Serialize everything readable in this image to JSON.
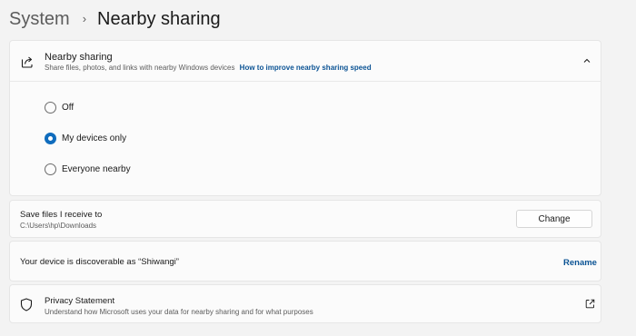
{
  "breadcrumb": {
    "parent": "System",
    "separator": "›",
    "current": "Nearby sharing"
  },
  "nearby_sharing": {
    "title": "Nearby sharing",
    "description": "Share files, photos, and links with nearby Windows devices",
    "help_link": "How to improve nearby sharing speed",
    "expanded": true,
    "options": [
      {
        "label": "Off",
        "checked": false
      },
      {
        "label": "My devices only",
        "checked": true
      },
      {
        "label": "Everyone nearby",
        "checked": false
      }
    ]
  },
  "save_files": {
    "title": "Save files I receive to",
    "path": "C:\\Users\\hp\\Downloads",
    "button_label": "Change"
  },
  "discoverable": {
    "text": "Your device is discoverable as “Shiwangi”",
    "action_label": "Rename"
  },
  "privacy": {
    "title": "Privacy Statement",
    "description": "Understand how Microsoft uses your data for nearby sharing and for what purposes"
  },
  "colors": {
    "accent": "#0f6cbd",
    "link": "#0b5394",
    "background": "#f3f3f3",
    "card": "#fbfbfb"
  },
  "icons": [
    "share-icon",
    "chevron-up-icon",
    "shield-icon",
    "open-external-icon"
  ]
}
